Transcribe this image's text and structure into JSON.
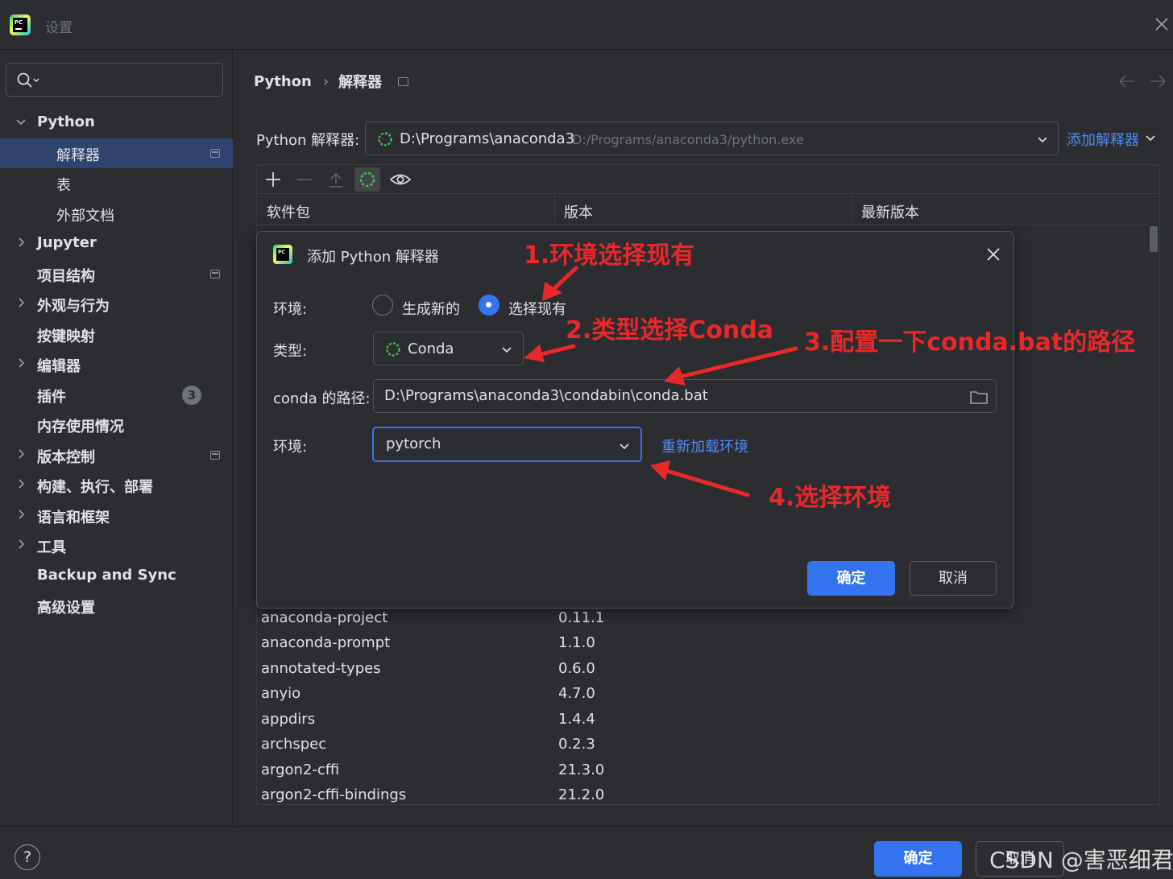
{
  "window": {
    "title": "设置"
  },
  "sidebar": {
    "search_placeholder": "",
    "items": [
      {
        "label": "Python"
      },
      {
        "label": "解释器"
      },
      {
        "label": "表"
      },
      {
        "label": "外部文档"
      },
      {
        "label": "Jupyter"
      },
      {
        "label": "项目结构"
      },
      {
        "label": "外观与行为"
      },
      {
        "label": "按键映射"
      },
      {
        "label": "编辑器"
      },
      {
        "label": "插件",
        "badge": "3"
      },
      {
        "label": "内存使用情况"
      },
      {
        "label": "版本控制"
      },
      {
        "label": "构建、执行、部署"
      },
      {
        "label": "语言和框架"
      },
      {
        "label": "工具"
      },
      {
        "label": "Backup and Sync"
      },
      {
        "label": "高级设置"
      }
    ]
  },
  "breadcrumb": {
    "root": "Python",
    "current": "解释器"
  },
  "interpreter": {
    "label": "Python 解释器:",
    "name": "D:\\Programs\\anaconda3",
    "path": "D:/Programs/anaconda3/python.exe",
    "add_link": "添加解释器"
  },
  "packages": {
    "columns": [
      "软件包",
      "版本",
      "最新版本"
    ],
    "rows": [
      {
        "name": "anaconda-project",
        "version": "0.11.1"
      },
      {
        "name": "anaconda-prompt",
        "version": "1.1.0"
      },
      {
        "name": "annotated-types",
        "version": "0.6.0"
      },
      {
        "name": "anyio",
        "version": "4.7.0"
      },
      {
        "name": "appdirs",
        "version": "1.4.4"
      },
      {
        "name": "archspec",
        "version": "0.2.3"
      },
      {
        "name": "argon2-cffi",
        "version": "21.3.0"
      },
      {
        "name": "argon2-cffi-bindings",
        "version": "21.2.0"
      }
    ]
  },
  "dialog": {
    "title": "添加 Python 解释器",
    "env_label": "环境:",
    "option_new": "生成新的",
    "option_existing": "选择现有",
    "selected_option": "选择现有",
    "type_label": "类型:",
    "type_value": "Conda",
    "conda_path_label": "conda 的路径:",
    "conda_path_value": "D:\\Programs\\anaconda3\\condabin\\conda.bat",
    "env2_label": "环境:",
    "env_value": "pytorch",
    "reload_link": "重新加载环境",
    "ok": "确定",
    "cancel": "取消"
  },
  "annotations": {
    "step1": "1.环境选择现有",
    "step2": "2.类型选择Conda",
    "step3": "3.配置一下conda.bat的路径",
    "step4": "4.选择环境",
    "color": "#e9282a"
  },
  "footer": {
    "help": "?",
    "ok": "确定",
    "cancel": "取消",
    "watermark": "CSDN @害恶细君"
  },
  "colors": {
    "accent": "#3574f0",
    "link": "#548af7",
    "selected_row": "#2e436e",
    "background": "#2b2d30"
  }
}
